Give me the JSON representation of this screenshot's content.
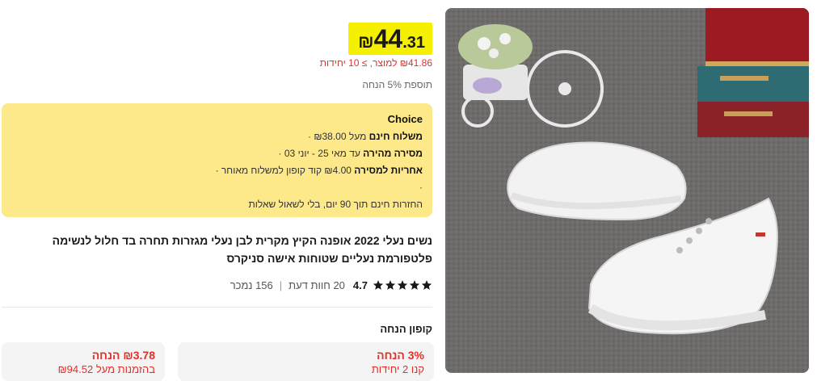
{
  "price": {
    "currency": "₪",
    "integer": "44",
    "decimal": ".31",
    "unit_price": "₪41.86 למוצר, ≥ 10 יחידות",
    "extra_discount": "תוספת 5% הנחה"
  },
  "choice": {
    "title": "Choice",
    "lines": [
      {
        "bold": "משלוח חינם",
        "text": " מעל ₪38.00 ·"
      },
      {
        "bold": "מסירה מהירה",
        "text": " עד מאי 25 - יוני 03 ·"
      },
      {
        "bold": "אחריות למסירה",
        "text": " ₪4.00 קוד קופון למשלוח מאוחר ·"
      },
      {
        "bold": "",
        "text": "·"
      },
      {
        "bold": "",
        "text": "החזרות חינם תוך 90 יום, בלי לשאול שאלות"
      }
    ]
  },
  "product": {
    "title": "נשים נעלי 2022 אופנה הקיץ מקרית לבן נעלי מגזרות תחרה בד חלול לנשימה פלטפורמת נעליים שטוחות אישה סניקרס",
    "rating": "4.7",
    "reviews": "20 חוות דעת",
    "sold": "156 נמכר",
    "stars": 5
  },
  "coupons": {
    "heading": "קופון הנחה",
    "cards": [
      {
        "line1": "3% הנחה",
        "line2": "קנו 2 יחידות"
      },
      {
        "line1": "₪3.78 הנחה",
        "line2": "בהזמנות מעל ₪94.52"
      }
    ]
  },
  "colors": {
    "price_highlight": "#f5f000",
    "choice_bg": "#fde98a",
    "discount_red": "#e0302a"
  }
}
